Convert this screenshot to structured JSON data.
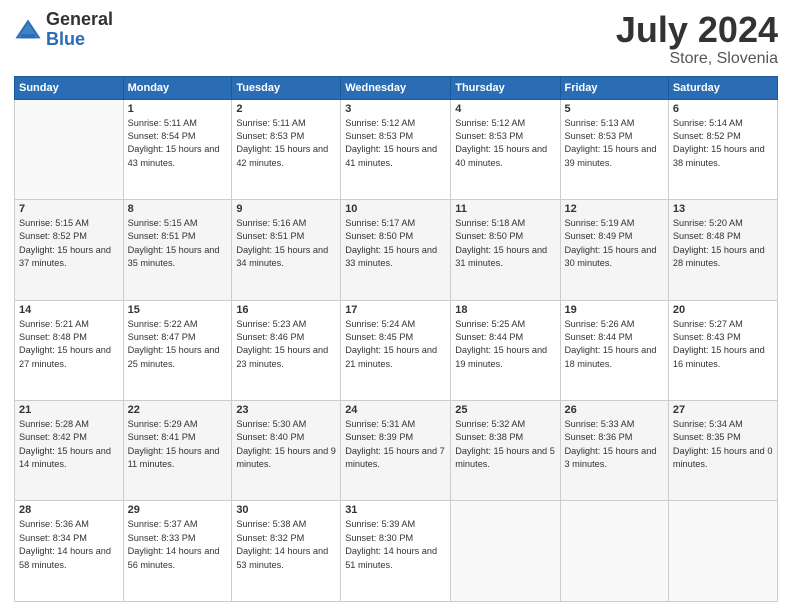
{
  "logo": {
    "general": "General",
    "blue": "Blue"
  },
  "title": {
    "month_year": "July 2024",
    "location": "Store, Slovenia"
  },
  "days_of_week": [
    "Sunday",
    "Monday",
    "Tuesday",
    "Wednesday",
    "Thursday",
    "Friday",
    "Saturday"
  ],
  "weeks": [
    [
      {
        "num": "",
        "empty": true
      },
      {
        "num": "1",
        "sunrise": "5:11 AM",
        "sunset": "8:54 PM",
        "daylight": "15 hours and 43 minutes."
      },
      {
        "num": "2",
        "sunrise": "5:11 AM",
        "sunset": "8:53 PM",
        "daylight": "15 hours and 42 minutes."
      },
      {
        "num": "3",
        "sunrise": "5:12 AM",
        "sunset": "8:53 PM",
        "daylight": "15 hours and 41 minutes."
      },
      {
        "num": "4",
        "sunrise": "5:12 AM",
        "sunset": "8:53 PM",
        "daylight": "15 hours and 40 minutes."
      },
      {
        "num": "5",
        "sunrise": "5:13 AM",
        "sunset": "8:53 PM",
        "daylight": "15 hours and 39 minutes."
      },
      {
        "num": "6",
        "sunrise": "5:14 AM",
        "sunset": "8:52 PM",
        "daylight": "15 hours and 38 minutes."
      }
    ],
    [
      {
        "num": "7",
        "sunrise": "5:15 AM",
        "sunset": "8:52 PM",
        "daylight": "15 hours and 37 minutes."
      },
      {
        "num": "8",
        "sunrise": "5:15 AM",
        "sunset": "8:51 PM",
        "daylight": "15 hours and 35 minutes."
      },
      {
        "num": "9",
        "sunrise": "5:16 AM",
        "sunset": "8:51 PM",
        "daylight": "15 hours and 34 minutes."
      },
      {
        "num": "10",
        "sunrise": "5:17 AM",
        "sunset": "8:50 PM",
        "daylight": "15 hours and 33 minutes."
      },
      {
        "num": "11",
        "sunrise": "5:18 AM",
        "sunset": "8:50 PM",
        "daylight": "15 hours and 31 minutes."
      },
      {
        "num": "12",
        "sunrise": "5:19 AM",
        "sunset": "8:49 PM",
        "daylight": "15 hours and 30 minutes."
      },
      {
        "num": "13",
        "sunrise": "5:20 AM",
        "sunset": "8:48 PM",
        "daylight": "15 hours and 28 minutes."
      }
    ],
    [
      {
        "num": "14",
        "sunrise": "5:21 AM",
        "sunset": "8:48 PM",
        "daylight": "15 hours and 27 minutes."
      },
      {
        "num": "15",
        "sunrise": "5:22 AM",
        "sunset": "8:47 PM",
        "daylight": "15 hours and 25 minutes."
      },
      {
        "num": "16",
        "sunrise": "5:23 AM",
        "sunset": "8:46 PM",
        "daylight": "15 hours and 23 minutes."
      },
      {
        "num": "17",
        "sunrise": "5:24 AM",
        "sunset": "8:45 PM",
        "daylight": "15 hours and 21 minutes."
      },
      {
        "num": "18",
        "sunrise": "5:25 AM",
        "sunset": "8:44 PM",
        "daylight": "15 hours and 19 minutes."
      },
      {
        "num": "19",
        "sunrise": "5:26 AM",
        "sunset": "8:44 PM",
        "daylight": "15 hours and 18 minutes."
      },
      {
        "num": "20",
        "sunrise": "5:27 AM",
        "sunset": "8:43 PM",
        "daylight": "15 hours and 16 minutes."
      }
    ],
    [
      {
        "num": "21",
        "sunrise": "5:28 AM",
        "sunset": "8:42 PM",
        "daylight": "15 hours and 14 minutes."
      },
      {
        "num": "22",
        "sunrise": "5:29 AM",
        "sunset": "8:41 PM",
        "daylight": "15 hours and 11 minutes."
      },
      {
        "num": "23",
        "sunrise": "5:30 AM",
        "sunset": "8:40 PM",
        "daylight": "15 hours and 9 minutes."
      },
      {
        "num": "24",
        "sunrise": "5:31 AM",
        "sunset": "8:39 PM",
        "daylight": "15 hours and 7 minutes."
      },
      {
        "num": "25",
        "sunrise": "5:32 AM",
        "sunset": "8:38 PM",
        "daylight": "15 hours and 5 minutes."
      },
      {
        "num": "26",
        "sunrise": "5:33 AM",
        "sunset": "8:36 PM",
        "daylight": "15 hours and 3 minutes."
      },
      {
        "num": "27",
        "sunrise": "5:34 AM",
        "sunset": "8:35 PM",
        "daylight": "15 hours and 0 minutes."
      }
    ],
    [
      {
        "num": "28",
        "sunrise": "5:36 AM",
        "sunset": "8:34 PM",
        "daylight": "14 hours and 58 minutes."
      },
      {
        "num": "29",
        "sunrise": "5:37 AM",
        "sunset": "8:33 PM",
        "daylight": "14 hours and 56 minutes."
      },
      {
        "num": "30",
        "sunrise": "5:38 AM",
        "sunset": "8:32 PM",
        "daylight": "14 hours and 53 minutes."
      },
      {
        "num": "31",
        "sunrise": "5:39 AM",
        "sunset": "8:30 PM",
        "daylight": "14 hours and 51 minutes."
      },
      {
        "num": "",
        "empty": true
      },
      {
        "num": "",
        "empty": true
      },
      {
        "num": "",
        "empty": true
      }
    ]
  ]
}
